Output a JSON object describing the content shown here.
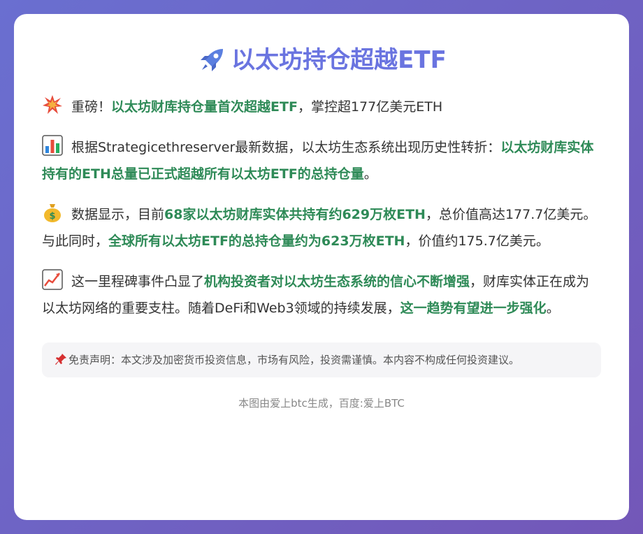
{
  "title": {
    "icon": "rocket-icon",
    "text": "以太坊持仓超越ETF"
  },
  "paragraphs": [
    {
      "icon": "collision-icon",
      "p1": "重磅！",
      "h1": "以太坊财库持仓量首次超越ETF",
      "p2": "，掌控超177亿美元ETH"
    },
    {
      "icon": "bar-chart-icon",
      "p1": "根据Strategicethreserver最新数据，以太坊生态系统出现历史性转折：",
      "h1": "以太坊财库实体持有的ETH总量已正式超越所有以太坊ETF的总持仓量",
      "p2": "。"
    },
    {
      "icon": "money-bag-icon",
      "p1": "数据显示，目前",
      "h1": "68家以太坊财库实体共持有约629万枚ETH",
      "p2": "，总价值高达177.7亿美元。与此同时，",
      "h2": "全球所有以太坊ETF的总持仓量约为623万枚ETH",
      "p3": "，价值约175.7亿美元。"
    },
    {
      "icon": "trend-up-icon",
      "p1": "这一里程碑事件凸显了",
      "h1": "机构投资者对以太坊生态系统的信心不断增强",
      "p2": "，财库实体正在成为以太坊网络的重要支柱。随着DeFi和Web3领域的持续发展，",
      "h2": "这一趋势有望进一步强化",
      "p3": "。"
    }
  ],
  "disclaimer": {
    "icon": "pushpin-icon",
    "text": "免责声明：本文涉及加密货币投资信息，市场有风险，投资需谨慎。本内容不构成任何投资建议。"
  },
  "footer": "本图由爱上btc生成，百度:爱上BTC",
  "colors": {
    "accent_title": "#6a74e0",
    "highlight": "#2e8a57",
    "background_start": "#6a6fd0",
    "background_end": "#7357b8"
  }
}
